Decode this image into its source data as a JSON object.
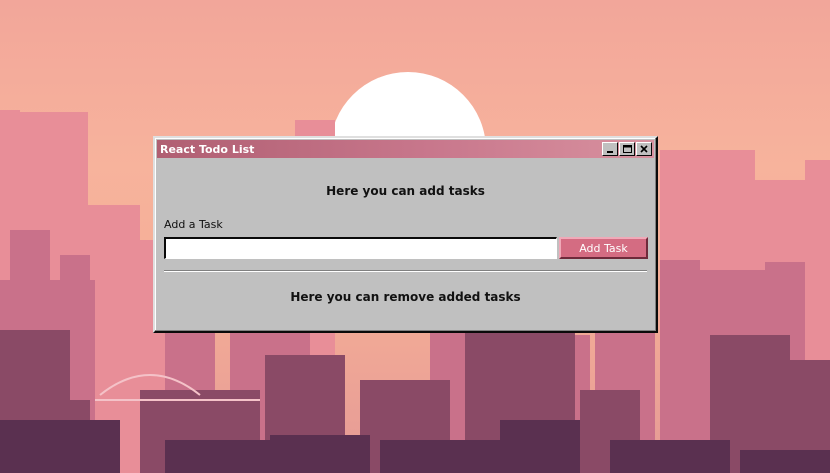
{
  "window": {
    "title": "React Todo List",
    "controls": {
      "minimize_icon": "minimize-icon",
      "maximize_icon": "maximize-icon",
      "close_icon": "close-icon"
    }
  },
  "add_section": {
    "heading": "Here you can add tasks",
    "field_label": "Add a Task",
    "input_value": "",
    "input_placeholder": "",
    "button_label": "Add Task"
  },
  "remove_section": {
    "heading": "Here you can remove added tasks"
  },
  "colors": {
    "titlebar_start": "#b05f72",
    "titlebar_end": "#d8919f",
    "window_face": "#c0c0c0",
    "accent_button": "#d46c82",
    "sky": "#f7b39c",
    "sun": "#ffffff"
  }
}
